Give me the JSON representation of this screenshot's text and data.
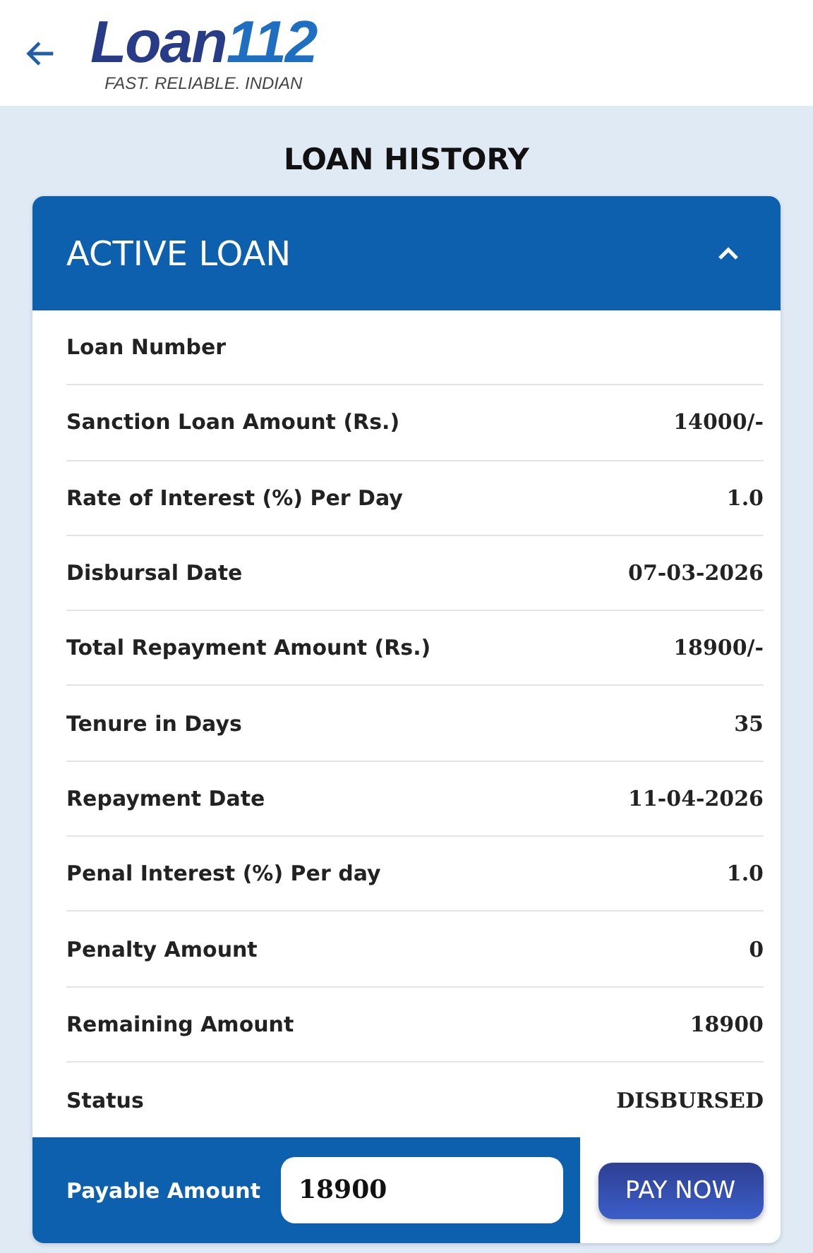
{
  "header": {
    "logo": {
      "primary": "Loan",
      "secondary": "112",
      "tagline": "FAST. RELIABLE. INDIAN"
    }
  },
  "page_title": "LOAN HISTORY",
  "loan_card": {
    "title": "ACTIVE LOAN",
    "expanded": true,
    "rows": [
      {
        "label": "Loan Number"
      },
      {
        "label": "Sanction Loan Amount (Rs.)",
        "value": "14000/-"
      },
      {
        "label": "Rate of Interest (%) Per Day",
        "value": "1.0"
      },
      {
        "label": "Disbursal Date",
        "value": "07-03-2026"
      },
      {
        "label": "Total Repayment Amount (Rs.)",
        "value": "18900/-"
      },
      {
        "label": "Tenure in Days",
        "value": "35"
      },
      {
        "label": "Repayment Date",
        "value": "11-04-2026"
      },
      {
        "label": "Penal Interest (%) Per day",
        "value": "1.0"
      },
      {
        "label": "Penalty Amount",
        "value": "0"
      },
      {
        "label": "Remaining Amount",
        "value": "18900"
      },
      {
        "label": "Status",
        "value": "DISBURSED"
      }
    ],
    "footer": {
      "label": "Payable Amount",
      "value": "18900",
      "button": "PAY NOW"
    }
  }
}
